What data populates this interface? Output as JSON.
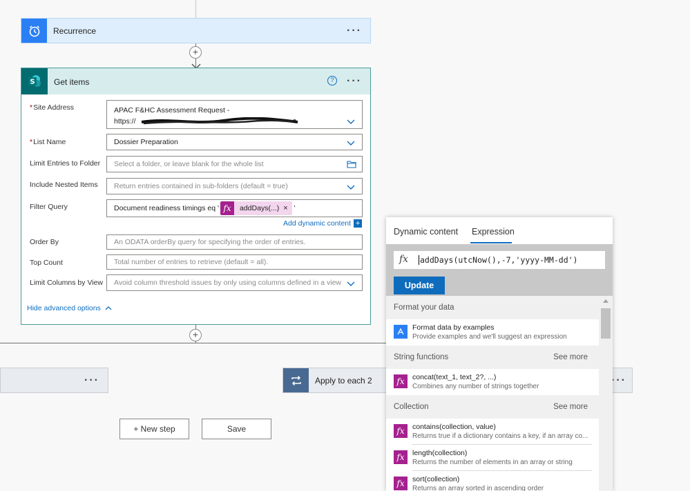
{
  "recurrence": {
    "title": "Recurrence",
    "more": "···"
  },
  "get_items": {
    "title": "Get items",
    "help": "?",
    "more": "···",
    "fields": {
      "site_address": {
        "label": "Site Address",
        "value_line1": "APAC F&HC Assessment Request -",
        "value_line2": "https://"
      },
      "list_name": {
        "label": "List Name",
        "value": "Dossier Preparation"
      },
      "limit_entries": {
        "label": "Limit Entries to Folder",
        "placeholder": "Select a folder, or leave blank for the whole list"
      },
      "include_nested": {
        "label": "Include Nested Items",
        "placeholder": "Return entries contained in sub-folders (default = true)"
      },
      "filter_query": {
        "label": "Filter Query",
        "text": "Document readiness timings eq '",
        "token": "addDays(...)",
        "token_remove": "×",
        "trailing": "'"
      },
      "order_by": {
        "label": "Order By",
        "placeholder": "An ODATA orderBy query for specifying the order of entries."
      },
      "top_count": {
        "label": "Top Count",
        "placeholder": "Total number of entries to retrieve (default = all)."
      },
      "limit_columns": {
        "label": "Limit Columns by View",
        "placeholder": "Avoid column threshold issues by only using columns defined in a view"
      }
    },
    "add_dynamic": "Add dynamic content",
    "hide_advanced": "Hide advanced options"
  },
  "bottom": {
    "apply_each": "Apply to each 2",
    "left_more": "···",
    "right_more": "···",
    "new_step": "+ New step",
    "save": "Save"
  },
  "expr_panel": {
    "tabs": [
      "Dynamic content",
      "Expression"
    ],
    "active_tab": "Expression",
    "expression": "addDays(utcNow(),-7,'yyyy-MM-dd')",
    "update": "Update",
    "sections": [
      {
        "title": "Format your data",
        "see_more": ""
      },
      {
        "title": "String functions",
        "see_more": "See more"
      },
      {
        "title": "Collection",
        "see_more": "See more"
      }
    ],
    "items": [
      {
        "title": "Format data by examples",
        "desc": "Provide examples and we'll suggest an expression"
      },
      {
        "title": "concat(text_1, text_2?, ...)",
        "desc": "Combines any number of strings together"
      },
      {
        "title": "contains(collection, value)",
        "desc": "Returns true if a dictionary contains a key, if an array co..."
      },
      {
        "title": "length(collection)",
        "desc": "Returns the number of elements in an array or string"
      },
      {
        "title": "sort(collection)",
        "desc": "Returns an array sorted in ascending order"
      }
    ]
  },
  "colors": {
    "recurrence_head": "#dfeefc",
    "recurrence_icon": "#2a7ff5",
    "getitems_head": "#d7eded",
    "sp_icon": "#036c70",
    "link": "#0f6cbd",
    "update_btn": "#0f6cbd",
    "fx": "#a5218f",
    "loop_icon": "#486991"
  }
}
